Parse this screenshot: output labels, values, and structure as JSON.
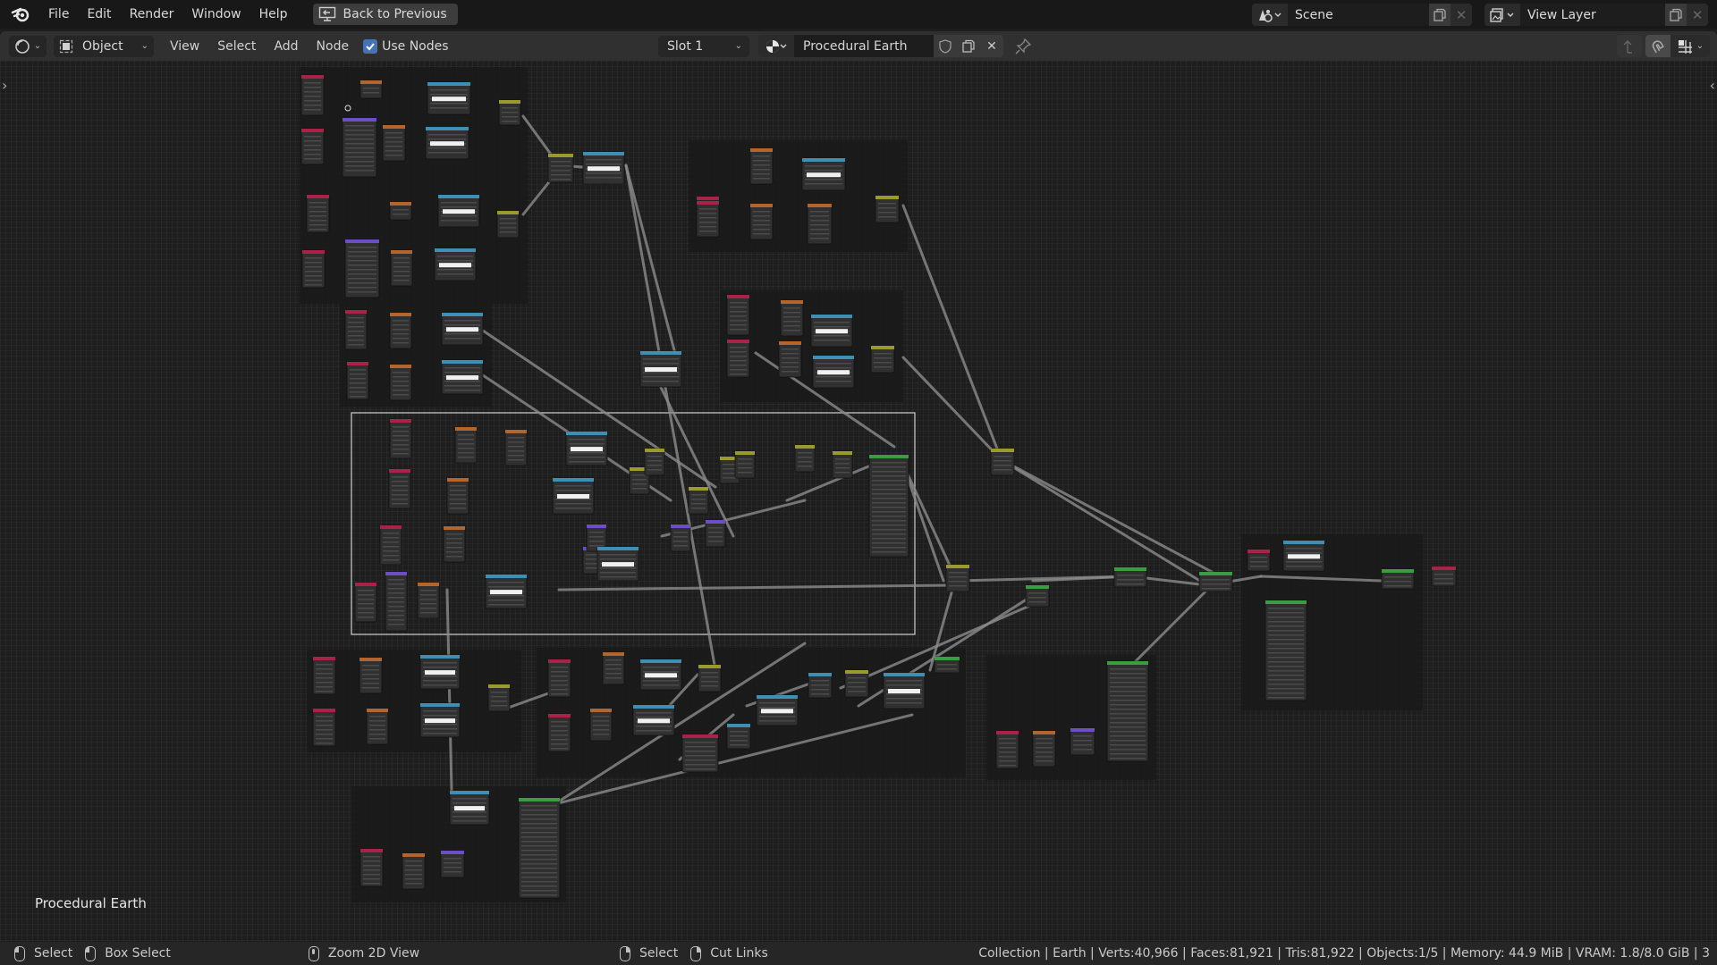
{
  "topbar": {
    "menus": [
      "File",
      "Edit",
      "Render",
      "Window",
      "Help"
    ],
    "back_button": "Back to Previous",
    "scene": {
      "value": "Scene"
    },
    "view_layer": {
      "value": "View Layer"
    }
  },
  "header": {
    "editor_type_icon": "node-editor-icon",
    "mode": "Object",
    "menus": [
      "View",
      "Select",
      "Add",
      "Node"
    ],
    "use_nodes": {
      "label": "Use Nodes",
      "checked": true
    },
    "slot": "Slot 1",
    "material_name": "Procedural Earth",
    "icons": [
      "fake-user-shield-icon",
      "duplicate-icon",
      "unlink-icon",
      "pin-icon",
      "parent-node-icon",
      "snap-icon",
      "snap-settings-icon"
    ]
  },
  "canvas": {
    "tree_name": "Procedural Earth",
    "colors": {
      "input": "#a8224a",
      "texture": "#b3652d",
      "converter_blue": "#3f8fb5",
      "vector": "#6c4fc4",
      "color_mix": "#9a9a2f",
      "shader": "#3b9d43",
      "output": "#a8224a",
      "node_body": "#303030",
      "frame": "#1a1a1a",
      "link": "#8c8c8c"
    }
  },
  "statusbar": {
    "hints": [
      {
        "mouse": "left",
        "label": "Select"
      },
      {
        "mouse": "left-drag",
        "label": "Box Select"
      },
      {
        "mouse": "middle",
        "label": "Zoom 2D View"
      },
      {
        "mouse": "right",
        "label": "Select"
      },
      {
        "mouse": "right-drag",
        "label": "Cut Links"
      }
    ],
    "stats": "Collection | Earth | Verts:40,966 | Faces:81,921 | Tris:81,922 | Objects:1/5 | Memory: 44.9 MiB | VRAM: 1.8/8.0 GiB | 3"
  }
}
